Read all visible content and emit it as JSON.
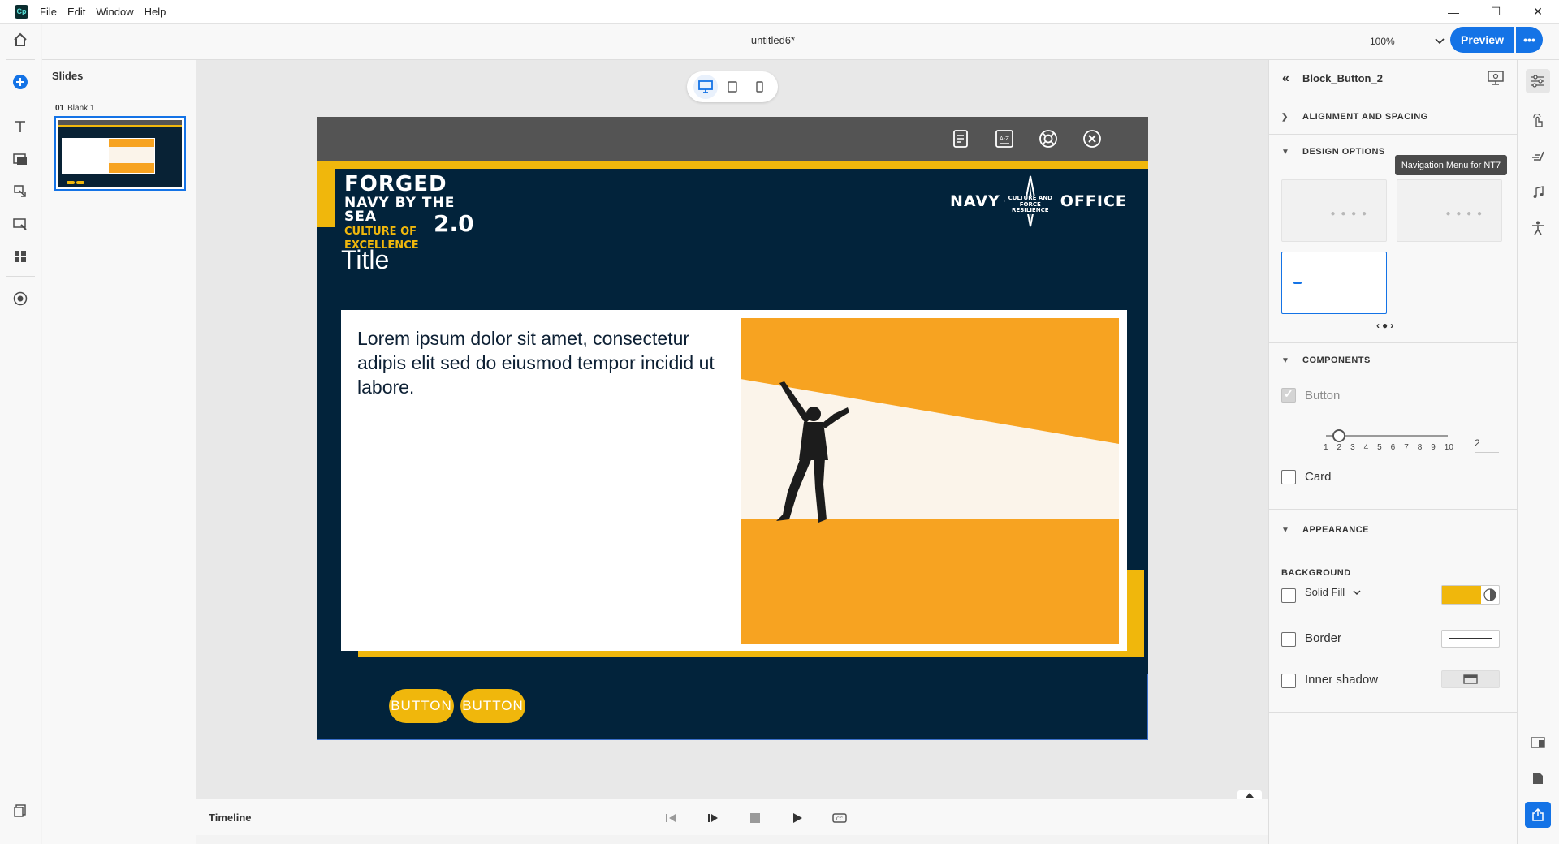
{
  "app": {
    "logo_text": "Cp",
    "menu": [
      "File",
      "Edit",
      "Window",
      "Help"
    ],
    "window_controls": {
      "minimize": "—",
      "maximize": "☐",
      "close": "✕"
    }
  },
  "topbar": {
    "document_title": "untitled6*",
    "zoom": "100%",
    "preview_label": "Preview",
    "more_label": "•••"
  },
  "slides_panel": {
    "title": "Slides",
    "slides": [
      {
        "number": "01",
        "name": "Blank 1"
      }
    ]
  },
  "slide": {
    "forged_lines": [
      "FORGED",
      "NAVY BY THE SEA",
      "CULTURE OF",
      "EXCELLENCE"
    ],
    "forged_version": "2.0",
    "navy_left": "NAVY",
    "navy_center": "CULTURE AND FORCE RESILIENCE",
    "navy_right": "OFFICE",
    "title": "Title",
    "body": "Lorem ipsum dolor sit amet, consectetur adipis elit sed do eiusmod tempor incidid ut labore.",
    "buttons": [
      "BUTTON",
      "BUTTON"
    ]
  },
  "timeline": {
    "label": "Timeline"
  },
  "properties": {
    "component_name": "Block_Button_2",
    "sections": {
      "alignment": "ALIGNMENT AND SPACING",
      "design": "DESIGN OPTIONS",
      "components": "COMPONENTS",
      "appearance": "APPEARANCE"
    },
    "tooltip": "Navigation Menu for NT7",
    "components": {
      "button_label": "Button",
      "button_checked": true,
      "slider_ticks": [
        "1",
        "2",
        "3",
        "4",
        "5",
        "6",
        "7",
        "8",
        "9",
        "10"
      ],
      "slider_value": "2",
      "card_label": "Card",
      "card_checked": false
    },
    "appearance": {
      "background_label": "BACKGROUND",
      "fill_type": "Solid Fill",
      "fill_color": "#f0b70c",
      "border_label": "Border",
      "inner_shadow_label": "Inner shadow"
    }
  },
  "colors": {
    "accent": "#1473e6",
    "slide_bg": "#02233b",
    "brand_yellow": "#f0b70c",
    "image_orange": "#f7a321"
  }
}
